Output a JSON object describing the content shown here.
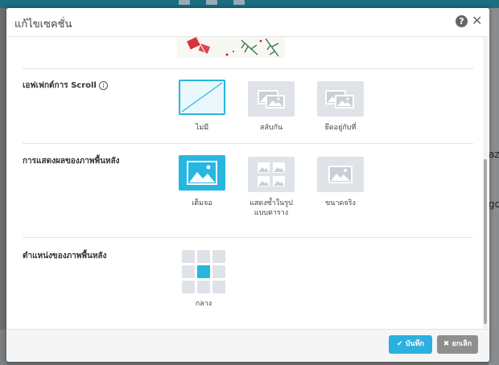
{
  "dialog": {
    "title": "แก้ไขเซคชั่น",
    "help_icon": "?",
    "close_icon": "✕"
  },
  "sections": {
    "scroll_effect": {
      "label": "เอฟเฟกต์การ Scroll",
      "info_icon": "i",
      "options": [
        {
          "label": "ไม่มี",
          "selected": true
        },
        {
          "label": "สลับกัน",
          "selected": false
        },
        {
          "label": "ยึดอยู่กับที่",
          "selected": false
        }
      ]
    },
    "bg_display": {
      "label": "การแสดงผลของภาพพื้นหลัง",
      "options": [
        {
          "label": "เต็มจอ",
          "selected": true
        },
        {
          "label": "แสดงซ้ำในรูปแบบตาราง",
          "selected": false
        },
        {
          "label": "ขนาดจริง",
          "selected": false
        }
      ]
    },
    "bg_position": {
      "label": "ตำแหน่งของภาพพื้นหลัง",
      "selected_label": "กลาง",
      "selected_cell": "center"
    }
  },
  "footer": {
    "save_label": "บันทึก",
    "cancel_label": "ยกเลิก"
  },
  "background_fragments": {
    "frag1": "az",
    "frag2": "go"
  },
  "colors": {
    "accent": "#27b6e0",
    "option_bg": "#dfe3e8",
    "cancel": "#8f8f8f"
  }
}
